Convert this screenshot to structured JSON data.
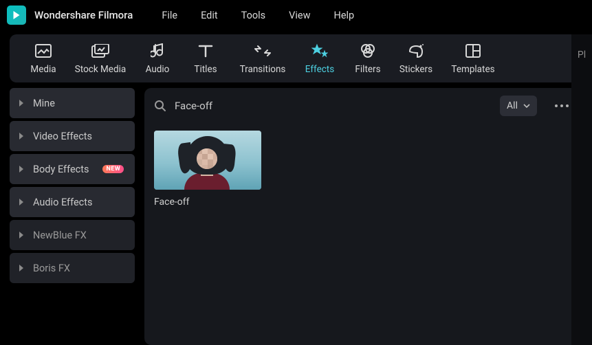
{
  "app_title": "Wondershare Filmora",
  "menubar": [
    "File",
    "Edit",
    "Tools",
    "View",
    "Help"
  ],
  "tools": [
    {
      "id": "media",
      "label": "Media"
    },
    {
      "id": "stock-media",
      "label": "Stock Media"
    },
    {
      "id": "audio",
      "label": "Audio"
    },
    {
      "id": "titles",
      "label": "Titles"
    },
    {
      "id": "transitions",
      "label": "Transitions"
    },
    {
      "id": "effects",
      "label": "Effects",
      "active": true
    },
    {
      "id": "filters",
      "label": "Filters"
    },
    {
      "id": "stickers",
      "label": "Stickers"
    },
    {
      "id": "templates",
      "label": "Templates"
    }
  ],
  "sidebar": [
    {
      "label": "Mine"
    },
    {
      "label": "Video Effects"
    },
    {
      "label": "Body Effects",
      "badge": "NEW"
    },
    {
      "label": "Audio Effects"
    },
    {
      "label": "NewBlue FX",
      "dim": true
    },
    {
      "label": "Boris FX",
      "dim": true
    }
  ],
  "search": {
    "query": "Face-off"
  },
  "filter_label": "All",
  "results": [
    {
      "label": "Face-off"
    }
  ],
  "right_panel_hint": "Pl"
}
